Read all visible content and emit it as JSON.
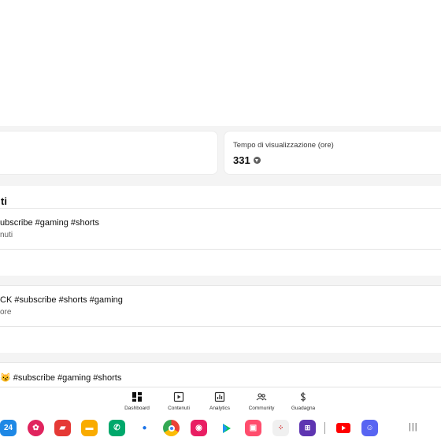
{
  "stats": {
    "right_label": "Tempo di visualizzazione (ore)",
    "right_value": "331"
  },
  "section": {
    "title": "ti",
    "videos": [
      {
        "title": "ubscribe #gaming #shorts",
        "sub": "nuti"
      },
      {
        "title": "CK #subscribe #shorts #gaming",
        "sub": "ore"
      },
      {
        "title": "😼 #subscribe #gaming #shorts",
        "sub": ""
      }
    ]
  },
  "bottom_nav": [
    {
      "label": "Dashboard",
      "icon": "dashboard-icon"
    },
    {
      "label": "Contenuti",
      "icon": "content-icon"
    },
    {
      "label": "Analytics",
      "icon": "analytics-icon"
    },
    {
      "label": "Community",
      "icon": "community-icon"
    },
    {
      "label": "Guadagna",
      "icon": "earn-icon"
    }
  ],
  "taskbar": {
    "calendar_date": "24",
    "apps": [
      "calendar-app-icon",
      "flower-app-icon",
      "notes-app-icon",
      "files-app-icon",
      "phone-app-icon",
      "messages-app-icon",
      "chrome-app-icon",
      "screen-recorder-app-icon",
      "play-store-app-icon",
      "galaxy-store-app-icon",
      "dice-app-icon",
      "good-lock-app-icon",
      "youtube-app-icon",
      "discord-app-icon"
    ],
    "recents_glyph": "|||"
  },
  "colors": {
    "accent": "#ff0000",
    "background": "#f4f4f4",
    "card": "#ffffff"
  }
}
